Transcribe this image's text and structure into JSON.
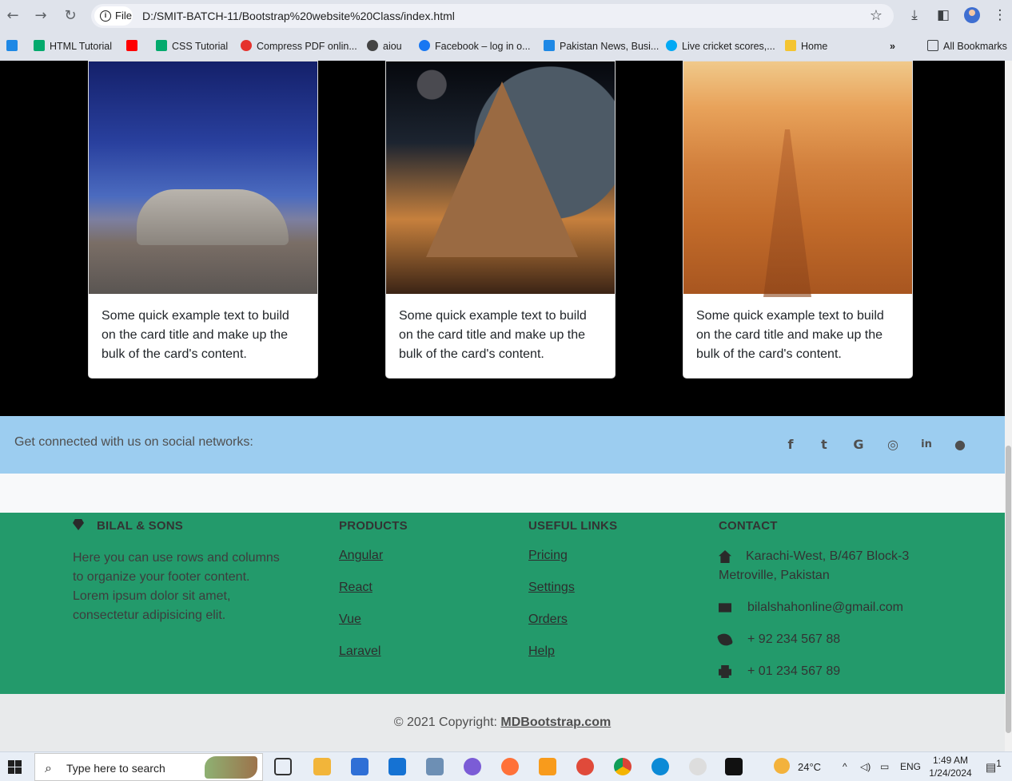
{
  "browser": {
    "site_chip": "File",
    "url": "D:/SMIT-BATCH-11/Bootstrap%20website%20Class/index.html",
    "bookmarks": [
      {
        "label": "HTML Tutorial",
        "color": "#04aa6d"
      },
      {
        "label": "",
        "color": "#ff0000"
      },
      {
        "label": "CSS Tutorial",
        "color": "#04aa6d"
      },
      {
        "label": "Compress PDF onlin...",
        "color": "#e5322d"
      },
      {
        "label": "aiou",
        "color": "#444444"
      },
      {
        "label": "Facebook – log in o...",
        "color": "#1877f2"
      },
      {
        "label": "Pakistan News, Busi...",
        "color": "#1e88e5"
      },
      {
        "label": "Live cricket scores,...",
        "color": "#03a9f4"
      },
      {
        "label": "Home",
        "color": "#f4c430"
      }
    ],
    "all_bookmarks": "All Bookmarks"
  },
  "cards": [
    {
      "text": "Some quick example text to build on the card title and make up the bulk of the card's content."
    },
    {
      "text": "Some quick example text to build on the card title and make up the bulk of the card's content."
    },
    {
      "text": "Some quick example text to build on the card title and make up the bulk of the card's content."
    }
  ],
  "social": {
    "text": "Get connected with us on social networks:",
    "icons": [
      "facebook-icon",
      "twitter-icon",
      "google-icon",
      "instagram-icon",
      "linkedin-icon",
      "github-icon"
    ],
    "glyphs": [
      "f",
      "t",
      "G",
      "◎",
      "in",
      "●"
    ]
  },
  "footer": {
    "brand": "BILAL & SONS",
    "about": "Here you can use rows and columns to organize your footer content. Lorem ipsum dolor sit amet, consectetur adipisicing elit.",
    "products_title": "PRODUCTS",
    "products": [
      "Angular",
      "React",
      "Vue",
      "Laravel"
    ],
    "useful_title": "USEFUL LINKS",
    "useful": [
      "Pricing",
      "Settings",
      "Orders",
      "Help"
    ],
    "contact_title": "CONTACT",
    "contact": {
      "address": "Karachi-West, B/467 Block-3 Metroville, Pakistan",
      "email": "bilalshahonline@gmail.com",
      "phone": "+ 92 234 567 88",
      "fax": "+ 01 234 567 89"
    },
    "copyright_prefix": "© 2021 Copyright: ",
    "copyright_link": "MDBootstrap.com"
  },
  "taskbar": {
    "search_placeholder": "Type here to search",
    "weather": "24°C",
    "lang": "ENG",
    "time": "1:49 AM",
    "date": "1/24/2024",
    "notifications": "1"
  },
  "colors": {
    "social_bar": "#9ccdf0",
    "footer": "#239a6b",
    "copyright_bar": "#e8eaeb"
  }
}
